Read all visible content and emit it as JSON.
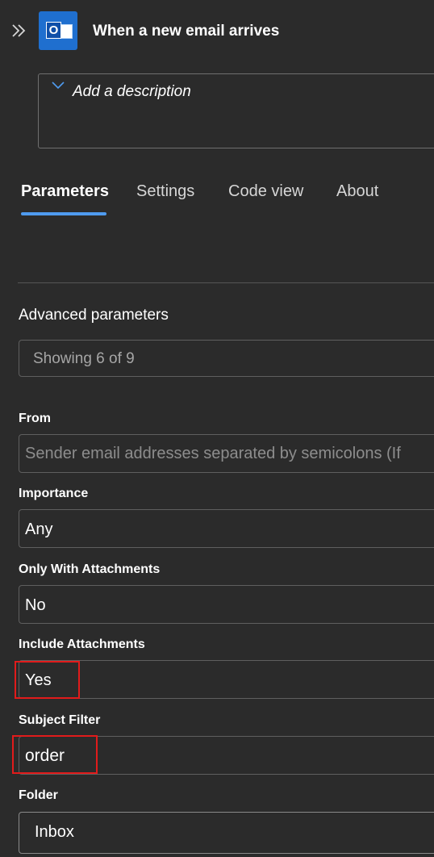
{
  "header": {
    "title": "When a new email arrives",
    "app_icon": "outlook-icon",
    "collapse_icon": "double-chevron-right-icon"
  },
  "description": {
    "placeholder": "Add a description"
  },
  "tabs": [
    {
      "label": "Parameters",
      "active": true
    },
    {
      "label": "Settings"
    },
    {
      "label": "Code view"
    },
    {
      "label": "About"
    }
  ],
  "advanced": {
    "label": "Advanced parameters",
    "showing": "Showing 6 of 9"
  },
  "fields": {
    "from": {
      "label": "From",
      "placeholder": "Sender email addresses separated by semicolons (If"
    },
    "importance": {
      "label": "Importance",
      "value": "Any"
    },
    "only_with_attachments": {
      "label": "Only With Attachments",
      "value": "No"
    },
    "include_attachments": {
      "label": "Include Attachments",
      "value": "Yes"
    },
    "subject_filter": {
      "label": "Subject Filter",
      "value": "order"
    },
    "folder": {
      "label": "Folder",
      "value": "Inbox"
    }
  },
  "colors": {
    "background": "#2b2b2b",
    "accent": "#4f9bef",
    "highlight": "#e11b1b"
  }
}
